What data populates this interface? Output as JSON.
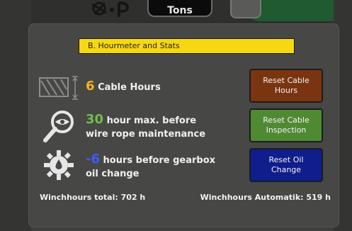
{
  "header": {
    "display_value": "Tons"
  },
  "section": {
    "title": "B. Hourmeter and Stats"
  },
  "cable": {
    "value": "6",
    "label": "Cable Hours",
    "value_color": "#f7b21e"
  },
  "wire_rope": {
    "value": "30",
    "line1": "hour max. before",
    "line2": "wire rope maintenance",
    "value_color": "#6ec04b"
  },
  "gearbox": {
    "value": "-6",
    "line1": "hours before gearbox",
    "line2": "oil change",
    "value_color": "#3b5cff"
  },
  "buttons": {
    "reset_cable_hours": "Reset Cable Hours",
    "reset_cable_inspection": "Reset Cable Inspection",
    "reset_oil_change": "Reset Oil Change"
  },
  "footer": {
    "winchhours_total": "Winchhours total: 702 h",
    "winchhours_automatik": "Winchhours Automatik: 519 h"
  },
  "icons": [
    "cable-drum-icon",
    "magnifier-eye-icon",
    "gear-oil-icon",
    "logo-icon"
  ]
}
